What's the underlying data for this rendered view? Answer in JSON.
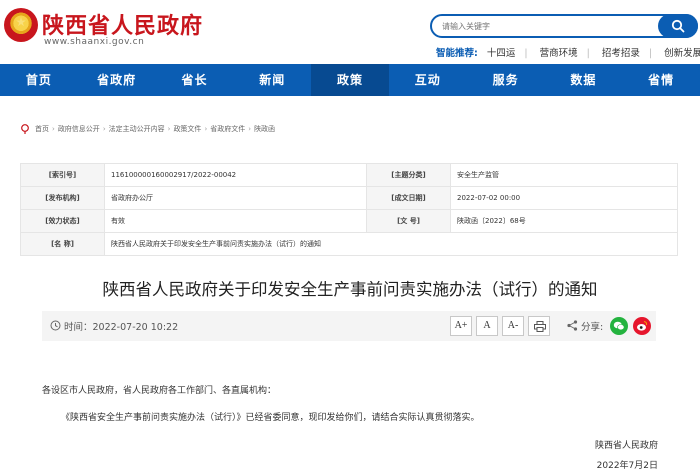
{
  "header": {
    "site_title": "陕西省人民政府",
    "site_url": "www.shaanxi.gov.cn",
    "search": {
      "placeholder": "请输入关键字"
    },
    "smart_label": "智能推荐:",
    "smart_items": [
      "十四运",
      "营商环境",
      "招考招录",
      "创新发展"
    ]
  },
  "nav": {
    "active": "政策",
    "items": [
      "首页",
      "省政府",
      "省长",
      "新闻",
      "政策",
      "互动",
      "服务",
      "数据",
      "省情"
    ]
  },
  "breadcrumb": [
    "首页",
    "政府信息公开",
    "法定主动公开内容",
    "政策文件",
    "省政府文件",
    "陕政函"
  ],
  "info": {
    "index_label": "[索引号]",
    "index_value": "11610000016000291​7/2022-00042",
    "topic_label": "[主题分类]",
    "topic_value": "安全生产监管",
    "issuer_label": "[发布机构]",
    "issuer_value": "省政府办公厅",
    "date_label": "[成文日期]",
    "date_value": "2022-07-02 00:00",
    "status_label": "[效力状态]",
    "status_value": "有效",
    "docno_label": "[文 号]",
    "docno_value": "陕政函〔2022〕68号",
    "name_label": "[名 称]",
    "name_value": "陕西省人民政府关于印发安全生产事前问责实施办法（试行）的通知"
  },
  "document": {
    "title": "陕西省人民政府关于印发安全生产事前问责实施办法（试行）的通知",
    "time_text": "时间：2022-07-20 10:22",
    "font_buttons": [
      "A+",
      "A",
      "A-"
    ],
    "share_label": "分享:",
    "para1": "各设区市人民政府，省人民政府各工作部门、各直属机构：",
    "para2": "《陕西省安全生产事前问责实施办法（试行）》已经省委同意，现印发给你们，请结合实际认真贯彻落实。",
    "sign_org": "陕西省人民政府",
    "sign_date": "2022年7月2日"
  },
  "colors": {
    "brand_red": "#c8161d",
    "nav_blue": "#0b5db3",
    "nav_active": "#074a91"
  },
  "icons": [
    "emblem-icon",
    "search-icon",
    "home-icon",
    "clock-icon",
    "print-icon",
    "share-icon",
    "wechat-icon",
    "weibo-icon"
  ]
}
